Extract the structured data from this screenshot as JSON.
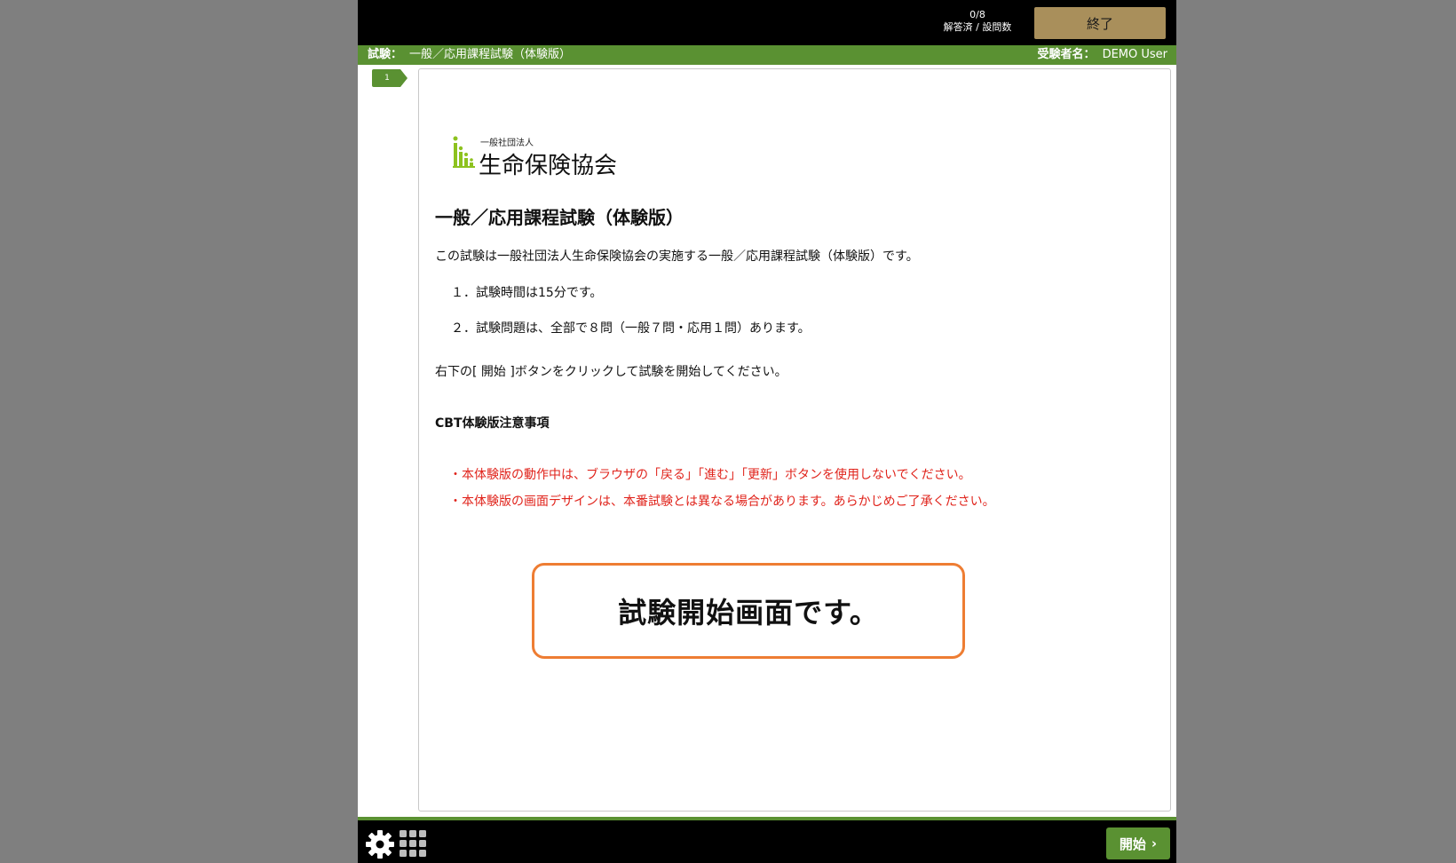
{
  "header": {
    "answered_count": "0/8",
    "answered_label": "解答済 / 設問数",
    "end_button_label": "終了"
  },
  "infobar": {
    "exam_label": "試験：",
    "exam_name": "一般／応用課程試験（体験版）",
    "examinee_label": "受験者名：",
    "examinee_name": "DEMO User"
  },
  "question_tab": {
    "number": "1"
  },
  "content": {
    "logo_small": "一般社団法人",
    "logo_large": "生命保険協会",
    "title": "一般／応用課程試験（体験版）",
    "intro": "この試験は一般社団法人生命保険協会の実施する一般／応用課程試験（体験版）です。",
    "items": [
      "１．試験時間は15分です。",
      "２．試験問題は、全部で８問（一般７問・応用１問）あります。"
    ],
    "instruction": "右下の[ 開始 ]ボタンをクリックして試験を開始してください。",
    "notes_heading": "CBT体験版注意事項",
    "notes": [
      "・本体験版の動作中は、ブラウザの「戻る」「進む」「更新」ボタンを使用しないでください。",
      "・本体験版の画面デザインは、本番試験とは異なる場合があります。あらかじめご了承ください。"
    ],
    "callout": "試験開始画面です。"
  },
  "footer": {
    "start_button_label": "開始",
    "settings_icon": "gear-icon",
    "grid_icon": "grid-icon"
  },
  "colors": {
    "accent_green": "#5a9132",
    "end_button": "#a98f5b",
    "note_red": "#e0231b",
    "callout_border": "#ee7d33"
  }
}
